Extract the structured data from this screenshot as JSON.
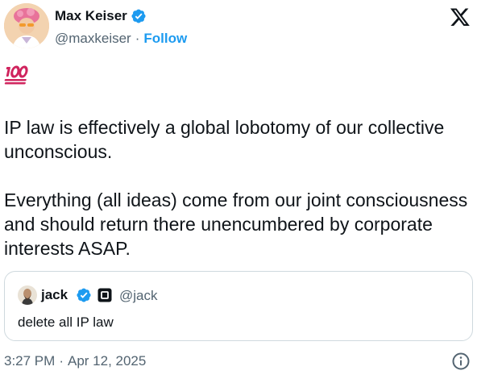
{
  "author": {
    "display_name": "Max Keiser",
    "handle": "@maxkeiser",
    "separator": "·",
    "follow_label": "Follow"
  },
  "emoji": "💯",
  "tweet": {
    "paragraphs": [
      "IP law is effectively a global lobotomy of our collective unconscious.",
      "Everything (all ideas) come from our joint consciousness and should return there unencumbered by corporate interests ASAP."
    ]
  },
  "quote": {
    "display_name": "jack",
    "handle": "@jack",
    "text": "delete all IP law"
  },
  "footer": {
    "time": "3:27 PM",
    "separator": "·",
    "date": "Apr 12, 2025"
  },
  "colors": {
    "accent": "#1d9bf0",
    "text": "#0f1419",
    "secondary": "#536471",
    "border": "#cfd9de"
  },
  "icons": {
    "brand": "x-logo-icon",
    "verified": "verified-badge-icon",
    "info": "info-icon"
  }
}
